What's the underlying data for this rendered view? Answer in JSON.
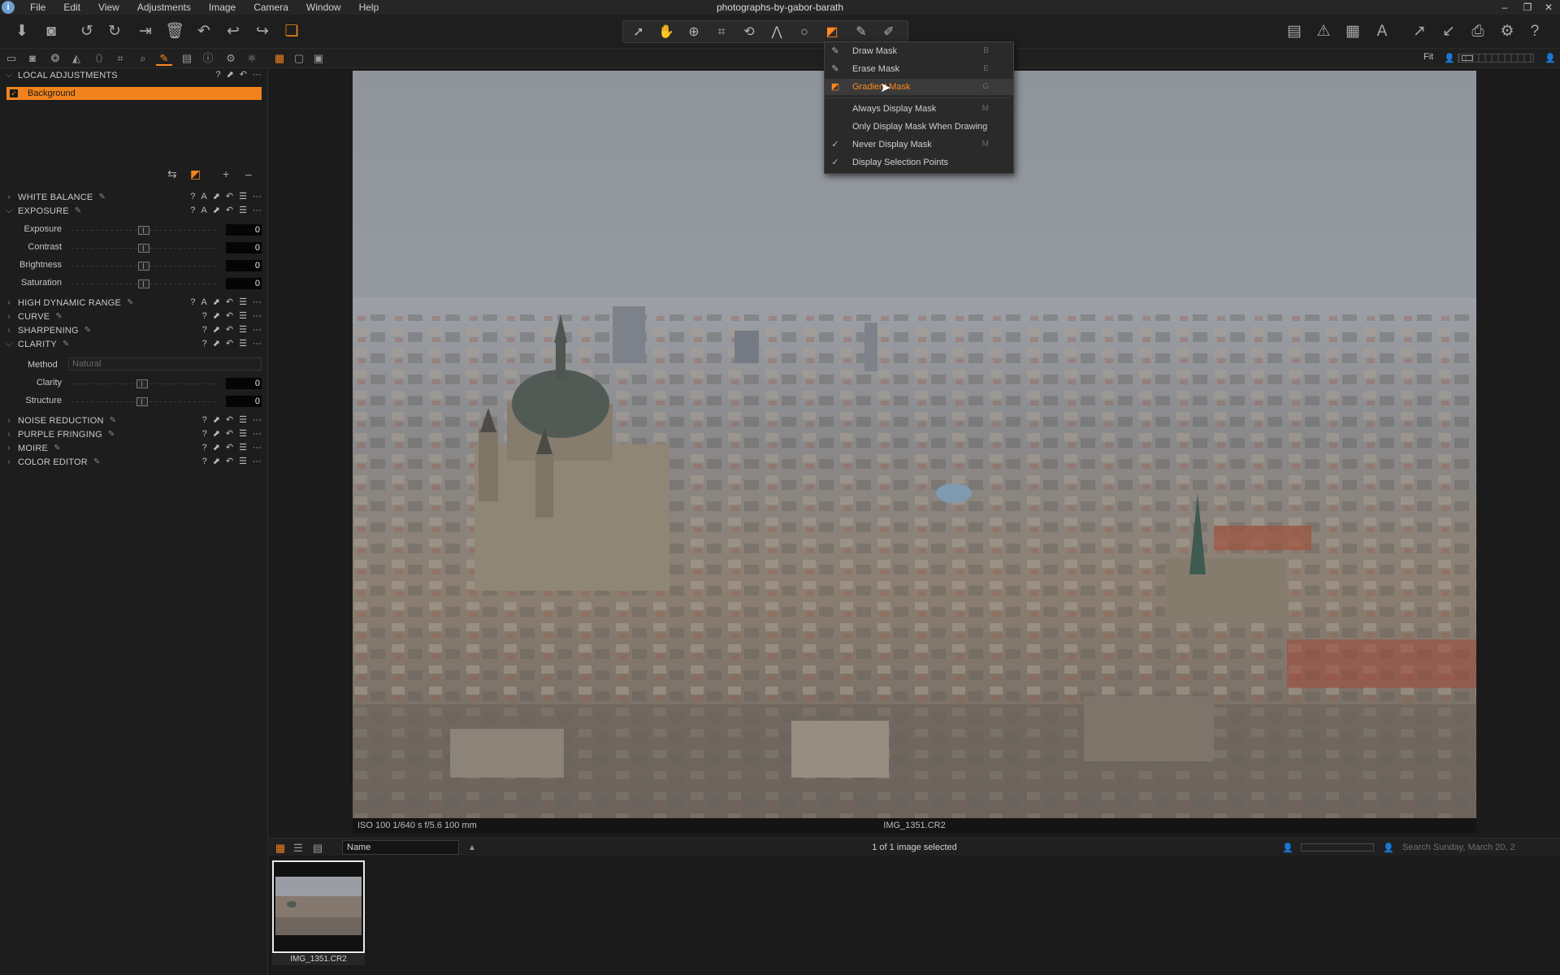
{
  "app": {
    "window_title": "photographs-by-gabor-barath",
    "menu": [
      "File",
      "Edit",
      "View",
      "Adjustments",
      "Image",
      "Camera",
      "Window",
      "Help"
    ]
  },
  "viewer": {
    "zoom_label": "Fit",
    "exif": "ISO 100  1/640 s  f/5.6  100 mm",
    "filename": "IMG_1351.CR2"
  },
  "cursor_dropdown": {
    "items": [
      {
        "label": "Draw Mask",
        "shortcut": "B"
      },
      {
        "label": "Erase Mask",
        "shortcut": "E"
      },
      {
        "label": "Gradient Mask",
        "shortcut": "G",
        "selected": true
      },
      {
        "label": "Always Display Mask",
        "shortcut": "M"
      },
      {
        "label": "Only Display Mask When Drawing",
        "shortcut": ""
      },
      {
        "label": "Never Display Mask",
        "shortcut": "M",
        "checked": true
      },
      {
        "label": "Display Selection Points",
        "shortcut": "",
        "checked": true
      }
    ]
  },
  "left_panel": {
    "local_adjustments": {
      "title": "LOCAL ADJUSTMENTS",
      "layer": "Background"
    },
    "white_balance": {
      "title": "WHITE BALANCE"
    },
    "exposure": {
      "title": "EXPOSURE",
      "sliders": [
        {
          "label": "Exposure",
          "value": "0"
        },
        {
          "label": "Contrast",
          "value": "0"
        },
        {
          "label": "Brightness",
          "value": "0"
        },
        {
          "label": "Saturation",
          "value": "0"
        }
      ]
    },
    "hdr": {
      "title": "HIGH DYNAMIC RANGE"
    },
    "curve": {
      "title": "CURVE"
    },
    "sharpening": {
      "title": "SHARPENING"
    },
    "clarity": {
      "title": "CLARITY",
      "method_label": "Method",
      "method_value": "Natural",
      "sliders": [
        {
          "label": "Clarity",
          "value": "0"
        },
        {
          "label": "Structure",
          "value": "0"
        }
      ]
    },
    "noise_reduction": {
      "title": "NOISE REDUCTION"
    },
    "purple_fringing": {
      "title": "PURPLE FRINGING"
    },
    "moire": {
      "title": "MOIRE"
    },
    "color_editor": {
      "title": "COLOR EDITOR"
    }
  },
  "browser": {
    "sort_by": "Name",
    "selection_status": "1 of 1 image selected",
    "search_placeholder": "Search Sunday, March 20, 2",
    "thumbnail_label": "IMG_1351.CR2"
  },
  "colors": {
    "accent": "#f0831c",
    "background": "#1b1b1b"
  }
}
